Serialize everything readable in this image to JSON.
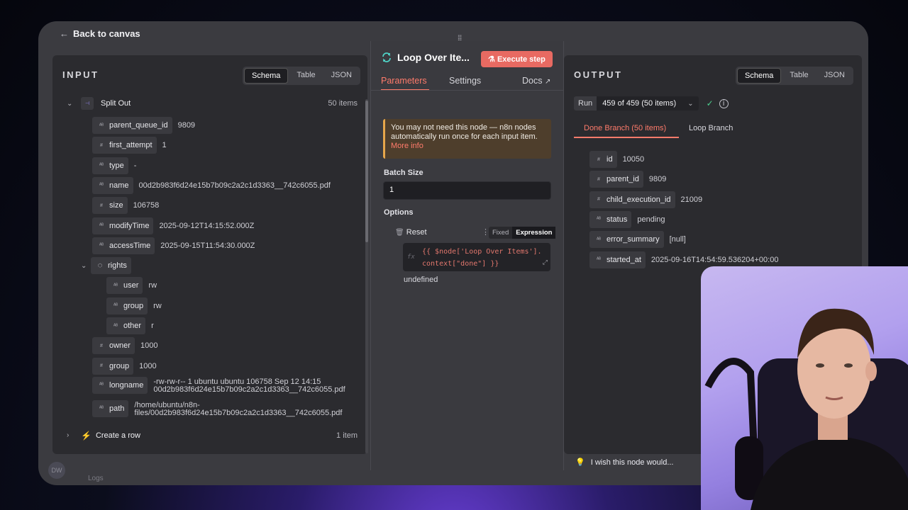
{
  "header": {
    "back_label": "Back to canvas"
  },
  "input": {
    "title": "INPUT",
    "views": [
      "Schema",
      "Table",
      "JSON"
    ],
    "active_view": "Schema",
    "root": {
      "label": "Split Out",
      "count": "50 items"
    },
    "fields": [
      {
        "type": "AB",
        "key": "parent_queue_id",
        "value": "9809"
      },
      {
        "type": "#",
        "key": "first_attempt",
        "value": "1"
      },
      {
        "type": "AB",
        "key": "type",
        "value": "-"
      },
      {
        "type": "AB",
        "key": "name",
        "value": "00d2b983f6d24e15b7b09c2a2c1d3363__742c6055.pdf"
      },
      {
        "type": "#",
        "key": "size",
        "value": "106758"
      },
      {
        "type": "AB",
        "key": "modifyTime",
        "value": "2025-09-12T14:15:52.000Z"
      },
      {
        "type": "AB",
        "key": "accessTime",
        "value": "2025-09-15T11:54:30.000Z"
      }
    ],
    "rights": {
      "key": "rights",
      "children": [
        {
          "type": "AB",
          "key": "user",
          "value": "rw"
        },
        {
          "type": "AB",
          "key": "group",
          "value": "rw"
        },
        {
          "type": "AB",
          "key": "other",
          "value": "r"
        }
      ]
    },
    "fields2": [
      {
        "type": "#",
        "key": "owner",
        "value": "1000"
      },
      {
        "type": "#",
        "key": "group",
        "value": "1000"
      }
    ],
    "longname": {
      "type": "AB",
      "key": "longname",
      "value_line1": "-rw-rw-r-- 1 ubuntu ubuntu 106758 Sep 12 14:15",
      "value_line2": "00d2b983f6d24e15b7b09c2a2c1d3363__742c6055.pdf"
    },
    "path": {
      "type": "AB",
      "key": "path",
      "value_line1": "/home/ubuntu/n8n-",
      "value_line2": "files/00d2b983f6d24e15b7b09c2a2c1d3363__742c6055.pdf"
    },
    "next_node": {
      "label": "Create a row",
      "count": "1 item"
    }
  },
  "node": {
    "title": "Loop Over Ite...",
    "execute_label": "Execute step",
    "tabs": [
      "Parameters",
      "Settings"
    ],
    "docs_label": "Docs",
    "warning_text": "You may not need this node — n8n nodes automatically run once for each input item.",
    "warning_link": "More info",
    "batch_label": "Batch Size",
    "batch_value": "1",
    "options_label": "Options",
    "reset_label": "Reset",
    "fixed_label": "Fixed",
    "expression_label": "Expression",
    "fx_label": "fx",
    "code_line1": "{{ $node['Loop Over Items'].",
    "code_line2": "context[\"done\"] }}",
    "result_text": "undefined"
  },
  "output": {
    "title": "OUTPUT",
    "views": [
      "Schema",
      "Table",
      "JSON"
    ],
    "active_view": "Schema",
    "run_label": "Run",
    "run_value": "459 of 459 (50 items)",
    "branches": [
      "Done Branch (50 items)",
      "Loop Branch"
    ],
    "fields": [
      {
        "type": "#",
        "key": "id",
        "value": "10050"
      },
      {
        "type": "#",
        "key": "parent_id",
        "value": "9809"
      },
      {
        "type": "#",
        "key": "child_execution_id",
        "value": "21009"
      },
      {
        "type": "AB",
        "key": "status",
        "value": "pending"
      },
      {
        "type": "AB",
        "key": "error_summary",
        "value": "[null]"
      },
      {
        "type": "AB",
        "key": "started_at",
        "value": "2025-09-16T14:54:59.536204+00:00"
      }
    ]
  },
  "footer": {
    "wish_text": "I wish this node would...",
    "avatar_initials": "DW",
    "logs_label": "Logs"
  },
  "colors": {
    "accent": "#ff7b6b",
    "execute": "#e86a62",
    "warning_border": "#e6a64b"
  }
}
